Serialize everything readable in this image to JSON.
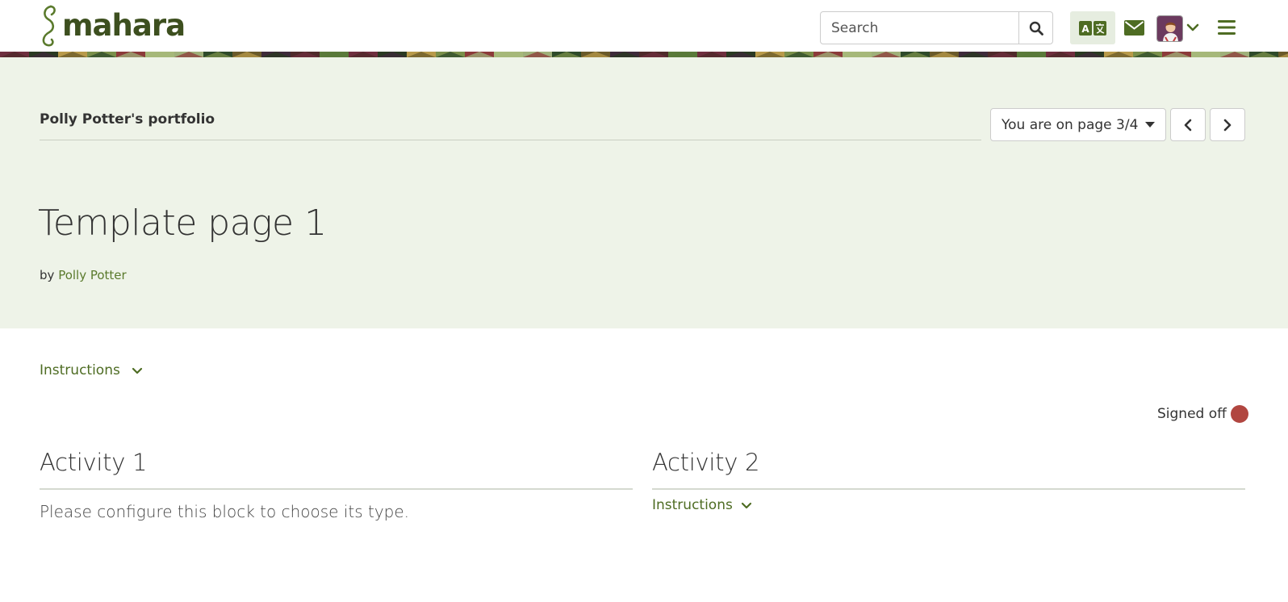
{
  "header": {
    "logo_text": "mahara",
    "search": {
      "placeholder": "Search",
      "value": ""
    },
    "icons": {
      "search": "search-icon",
      "language": "language-icon",
      "messages": "envelope-icon",
      "user_menu": "chevron-down-icon",
      "main_menu": "hamburger-menu-icon"
    }
  },
  "collection": {
    "title": "Polly Potter's portfolio",
    "page_selector": "You are on page 3/4"
  },
  "page": {
    "title": "Template page 1",
    "by_label": "by",
    "author": "Polly Potter"
  },
  "main": {
    "instructions_label": "Instructions",
    "signoff_label": "Signed off",
    "blocks": [
      {
        "title": "Activity 1",
        "body": "Please configure this block to choose its type."
      },
      {
        "title": "Activity 2",
        "instructions_label": "Instructions"
      }
    ]
  },
  "colors": {
    "brand": "#3d4f1f",
    "link": "#4e6c23",
    "banner_bg": "#eef3e8",
    "signed_off": "#b14640"
  }
}
